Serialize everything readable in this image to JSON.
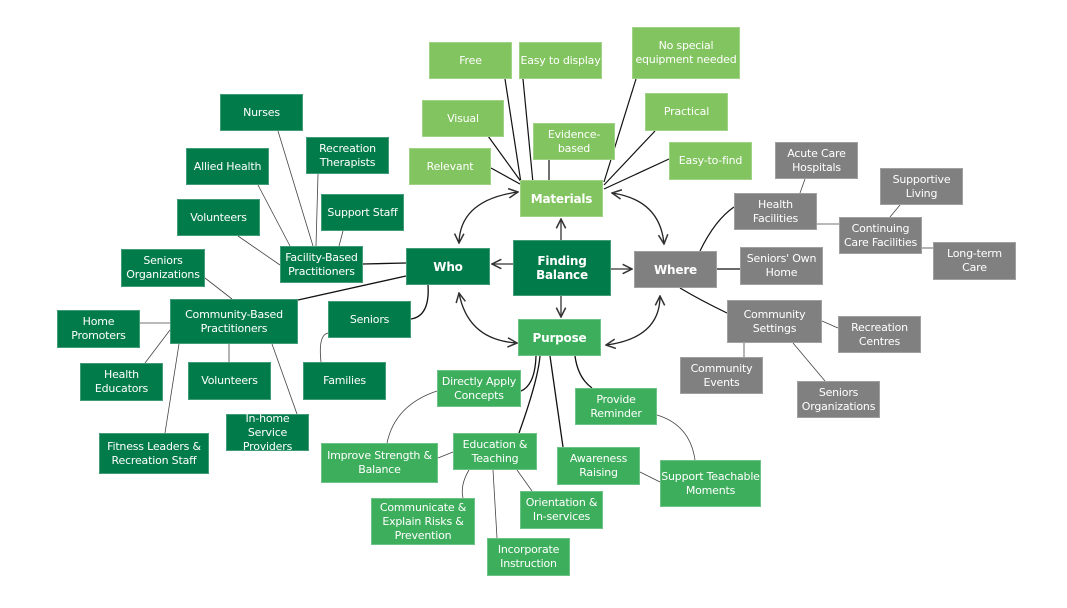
{
  "title": "Finding Balance",
  "colors": {
    "dark_green": "#027b4a",
    "light_green": "#82c45f",
    "mid_green": "#3dae5c",
    "gray": "#808080"
  },
  "nodes": {
    "center": "Finding\nBalance",
    "materials": "Materials",
    "who": "Who",
    "where": "Where",
    "purpose": "Purpose",
    "m_free": "Free",
    "m_easy_display": "Easy to display",
    "m_no_special": "No special\nequipment needed",
    "m_visual": "Visual",
    "m_evidence": "Evidence-based",
    "m_practical": "Practical",
    "m_relevant": "Relevant",
    "m_easy_find": "Easy-to-find",
    "w_nurses": "Nurses",
    "w_rec_therapists": "Recreation\nTherapists",
    "w_allied": "Allied Health",
    "w_support": "Support Staff",
    "w_volunteers1": "Volunteers",
    "w_facility": "Facility-Based\nPractitioners",
    "w_seniors_orgs": "Seniors\nOrganizations",
    "w_community": "Community-Based\nPractitioners",
    "w_home_promoters": "Home\nPromoters",
    "w_health_educators": "Health\nEducators",
    "w_volunteers2": "Volunteers",
    "w_inhome": "In-home Service\nProviders",
    "w_fitness": "Fitness Leaders &\nRecreation Staff",
    "w_seniors": "Seniors",
    "w_families": "Families",
    "h_health_fac": "Health\nFacilities",
    "h_acute": "Acute Care\nHospitals",
    "h_supportive": "Supportive\nLiving",
    "h_continuing": "Continuing\nCare Facilities",
    "h_longterm": "Long-term Care",
    "h_own_home": "Seniors' Own\nHome",
    "h_comm_settings": "Community\nSettings",
    "h_rec_centres": "Recreation\nCentres",
    "h_comm_events": "Community\nEvents",
    "h_seniors_orgs": "Seniors\nOrganizations",
    "p_directly": "Directly Apply\nConcepts",
    "p_reminder": "Provide\nReminder",
    "p_improve": "Improve Strength &\nBalance",
    "p_education": "Education &\nTeaching",
    "p_awareness": "Awareness\nRaising",
    "p_teachable": "Support Teachable\nMoments",
    "p_communicate": "Communicate &\nExplain Risks &\nPrevention",
    "p_orientation": "Orientation &\nIn-services",
    "p_incorporate": "Incorporate\nInstruction"
  }
}
